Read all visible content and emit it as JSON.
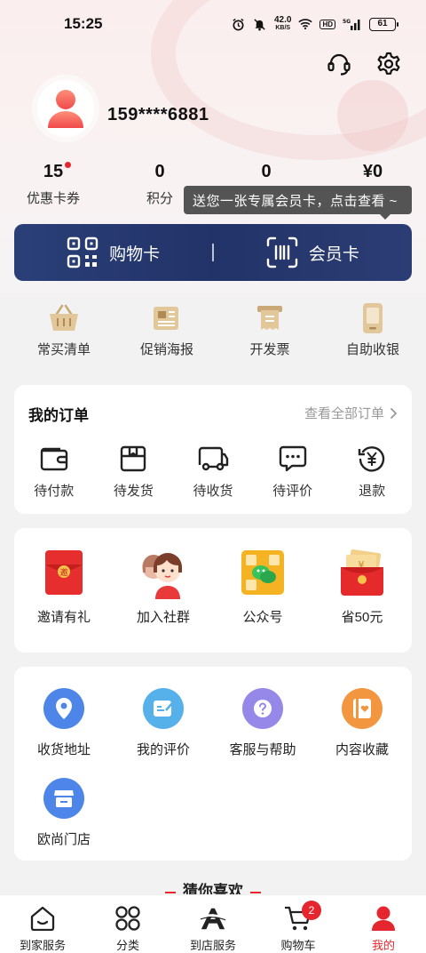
{
  "status_bar": {
    "time": "15:25",
    "net_speed": "42.0",
    "net_unit": "KB/S",
    "hd": "HD",
    "signal": "5G",
    "battery": "61"
  },
  "profile": {
    "phone": "159****6881"
  },
  "stats": [
    {
      "value": "15",
      "label": "优惠卡券",
      "has_dot": true
    },
    {
      "value": "0",
      "label": "积分"
    },
    {
      "value": "0",
      "label": ""
    },
    {
      "value": "¥0",
      "label": ""
    }
  ],
  "tooltip": "送您一张专属会员卡，点击查看 ~",
  "cards": {
    "shopping": "购物卡",
    "member": "会员卡"
  },
  "quick": [
    "常买清单",
    "促销海报",
    "开发票",
    "自助收银"
  ],
  "orders": {
    "title": "我的订单",
    "view_all": "查看全部订单",
    "items": [
      "待付款",
      "待发货",
      "待收货",
      "待评价",
      "退款"
    ]
  },
  "promo": [
    "邀请有礼",
    "加入社群",
    "公众号",
    "省50元"
  ],
  "services": [
    "收货地址",
    "我的评价",
    "客服与帮助",
    "内容收藏",
    "欧尚门店"
  ],
  "guess": "猜你喜欢",
  "tabs": [
    {
      "label": "到家服务"
    },
    {
      "label": "分类"
    },
    {
      "label": "到店服务"
    },
    {
      "label": "购物车",
      "badge": "2"
    },
    {
      "label": "我的",
      "active": true
    }
  ],
  "colors": {
    "accent": "#e6262e",
    "card_bar": "#223368"
  }
}
